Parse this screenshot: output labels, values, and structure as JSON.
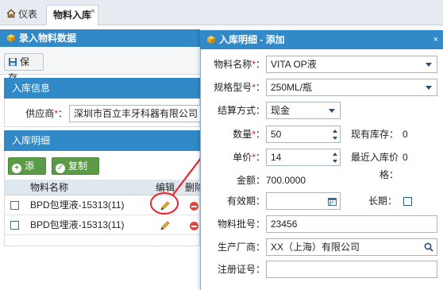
{
  "tabs": {
    "dashboard": "仪表盘",
    "receiving": "物料入库",
    "close": "×"
  },
  "left": {
    "header": "录入物料数据",
    "save": "保存",
    "info_section": "入库信息",
    "supplier_label": "供应商",
    "required_mark": "*",
    "supplier_value": "深圳市百立丰牙科器有限公司",
    "detail_section": "入库明细",
    "add": "添加",
    "copy_row": "复制行",
    "columns": [
      "物料名称",
      "编辑",
      "删除"
    ],
    "rows": [
      {
        "name": "BPD包埋液-15313(11)"
      },
      {
        "name": "BPD包埋液-15313(11)"
      }
    ]
  },
  "dialog": {
    "title": "入库明细 - 添加",
    "close": "×",
    "material_name_label": "物料名称",
    "material_name_value": "VITA OP液",
    "spec_label": "规格型号",
    "spec_value": "250ML/瓶",
    "settlement_label": "结算方式",
    "settlement_value": "现金",
    "quantity_label": "数量",
    "quantity_value": "50",
    "stock_label": "现有库存",
    "stock_value": "0",
    "price_label": "单价",
    "price_value": "14",
    "last_price_label": "最近入库价格",
    "last_price_value": "0",
    "amount_label": "金额",
    "amount_value": "700.0000",
    "expiry_label": "有效期",
    "long_term_label": "长期",
    "batch_label": "物料批号",
    "batch_value": "23456",
    "manufacturer_label": "生产厂商",
    "manufacturer_value": "XX（上海）有限公司",
    "reg_label": "注册证号",
    "colon": "：",
    "colon_star": "*："
  },
  "colors": {
    "accent": "#3289c8",
    "annotation": "#e8262b",
    "green": "#5b9b48"
  }
}
